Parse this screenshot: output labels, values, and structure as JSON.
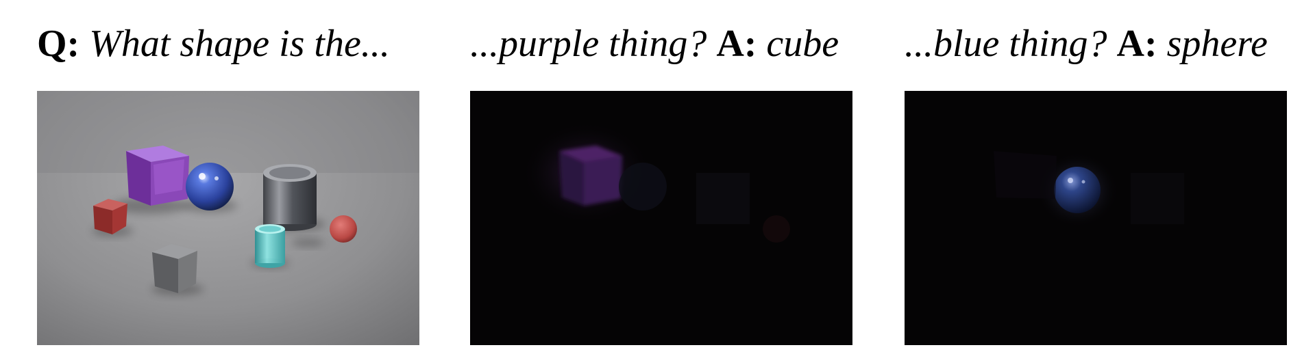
{
  "captions": {
    "left": {
      "q_label": "Q:",
      "q_text": "What shape is the..."
    },
    "middle": {
      "question": "...purple thing?",
      "a_label": "A:",
      "answer": "cube"
    },
    "right": {
      "question": "...blue thing?",
      "a_label": "A:",
      "answer": "sphere"
    }
  },
  "panels": {
    "left": {
      "kind": "scene",
      "background": "#8d8d8f"
    },
    "middle": {
      "kind": "attention",
      "background": "#050405",
      "highlight_color": "#7a3aa0"
    },
    "right": {
      "kind": "attention",
      "background": "#050405",
      "highlight_color": "#3d57a8"
    }
  },
  "colors": {
    "cube_purple": "#8a48b8",
    "sphere_blue": "#3554b8",
    "cylinder_gray": "#6d7076",
    "cube_red": "#a43634",
    "sphere_red": "#c65553",
    "cylinder_cyan": "#5fc8c8",
    "cube_gray": "#77787a"
  }
}
